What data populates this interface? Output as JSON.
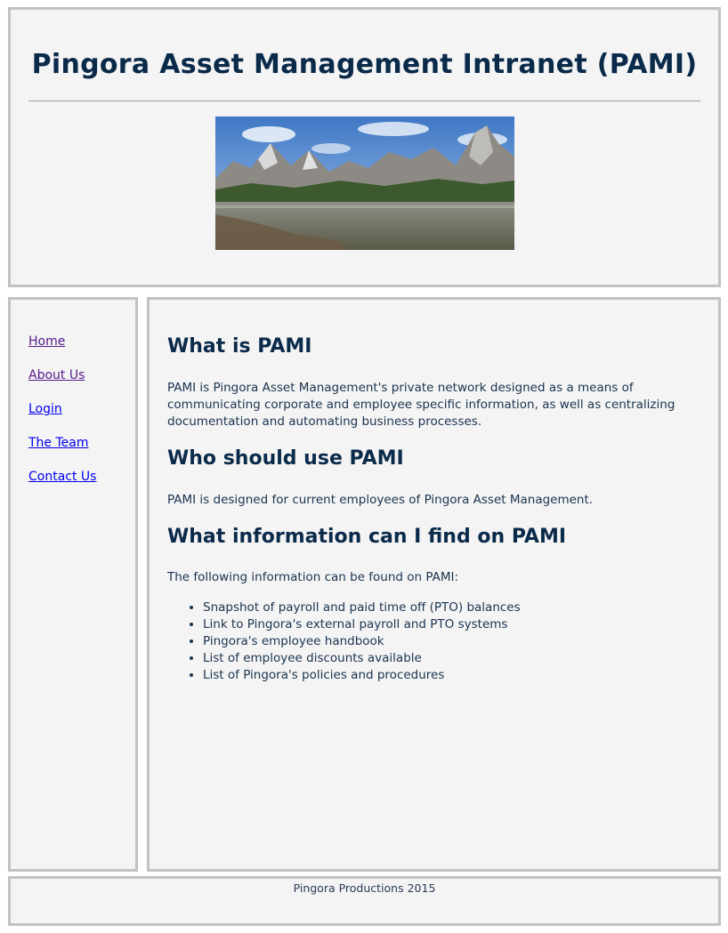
{
  "header": {
    "title": "Pingora Asset Management Intranet (PAMI)",
    "banner_image": "mountain-lake-panorama"
  },
  "sidebar": {
    "items": [
      {
        "label": "Home"
      },
      {
        "label": "About Us"
      },
      {
        "label": "Login"
      },
      {
        "label": "The Team"
      },
      {
        "label": "Contact Us"
      }
    ]
  },
  "main": {
    "sections": [
      {
        "heading": "What is PAMI",
        "text": "PAMI is Pingora Asset Management's private network designed as a means of communicating corporate and employee specific information, as well as centralizing documentation and automating business processes."
      },
      {
        "heading": "Who should use PAMI",
        "text": "PAMI is designed for current employees of Pingora Asset Management."
      },
      {
        "heading": "What information can I find on PAMI",
        "text": "The following information can be found on PAMI:"
      }
    ],
    "list": [
      "Snapshot of payroll and paid time off (PTO) balances",
      "Link to Pingora's external payroll and PTO systems",
      "Pingora's employee handbook",
      "List of employee discounts available",
      "List of Pingora's policies and procedures"
    ]
  },
  "footer": {
    "text": "Pingora Productions 2015"
  },
  "colors": {
    "panel_bg": "#f4f4f4",
    "panel_border": "#c2c2c2",
    "heading": "#0a2a4a",
    "link_visited": "#551a8b",
    "link_unvisited": "#0000ee"
  }
}
